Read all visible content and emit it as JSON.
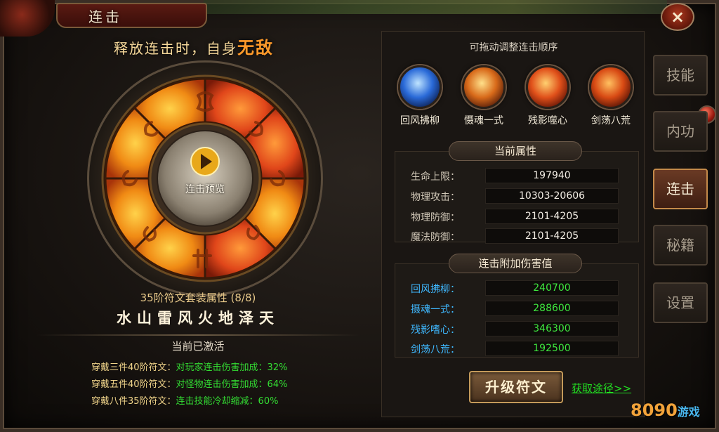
{
  "window": {
    "title": "连击",
    "close_icon": "×"
  },
  "tagline": {
    "prefix": "释放连击时，自身",
    "emphasis": "无敌"
  },
  "wheel": {
    "center_label": "连击预览"
  },
  "set": {
    "title": "35阶符文套装属性 (8/8)",
    "elements": "水山雷风火地泽天"
  },
  "active": {
    "title": "当前已激活",
    "bonuses": [
      {
        "key": "穿戴三件40阶符文：",
        "value": "对玩家连击伤害加成：32%"
      },
      {
        "key": "穿戴五件40阶符文：",
        "value": "对怪物连击伤害加成：64%"
      },
      {
        "key": "穿戴八件35阶符文：",
        "value": "连击技能冷却缩减：60%"
      }
    ]
  },
  "right": {
    "caption": "可拖动调整连击顺序",
    "skills": [
      {
        "name": "回风拂柳",
        "color": "#2a6ad8"
      },
      {
        "name": "慑魂一式",
        "color": "#d86a1a"
      },
      {
        "name": "残影噬心",
        "color": "#e0501a"
      },
      {
        "name": "剑荡八荒",
        "color": "#d84a14"
      }
    ],
    "stats_title": "当前属性",
    "stats": [
      {
        "label": "生命上限：",
        "value": "197940"
      },
      {
        "label": "物理攻击：",
        "value": "10303-20606"
      },
      {
        "label": "物理防御：",
        "value": "2101-4205"
      },
      {
        "label": "魔法防御：",
        "value": "2101-4205"
      }
    ],
    "damage_title": "连击附加伤害值",
    "damage": [
      {
        "label": "回风拂柳：",
        "value": "240700"
      },
      {
        "label": "摄魂一式：",
        "value": "288600"
      },
      {
        "label": "残影嗜心：",
        "value": "346300"
      },
      {
        "label": "剑荡八荒：",
        "value": "192500"
      }
    ],
    "upgrade_label": "升级符文",
    "get_link": "获取途径>>"
  },
  "tabs": [
    "技能",
    "内功",
    "连击",
    "秘籍",
    "设置"
  ],
  "active_tab": "连击",
  "watermark": {
    "main": "8090",
    "sub": "游戏"
  }
}
